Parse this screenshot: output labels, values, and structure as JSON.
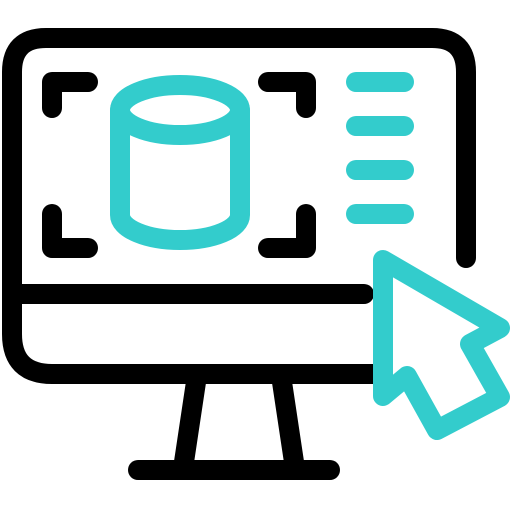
{
  "icon": {
    "name": "3d-modeling-monitor-icon",
    "parts": [
      "monitor-icon",
      "cylinder-icon",
      "crop-frame-icon",
      "menu-lines-icon",
      "cursor-arrow-icon"
    ]
  },
  "colors": {
    "outline": "#000000",
    "accent": "#33CCCC",
    "background": "#FFFFFF"
  }
}
